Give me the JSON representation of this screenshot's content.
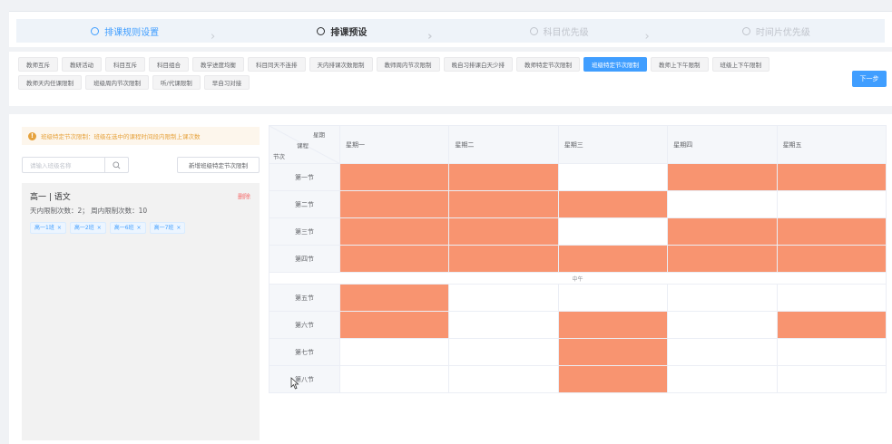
{
  "steps": [
    {
      "label": "排课规则设置",
      "state": "done"
    },
    {
      "label": "排课预设",
      "state": "active"
    },
    {
      "label": "科目优先级",
      "state": "todo"
    },
    {
      "label": "时间片优先级",
      "state": "todo"
    }
  ],
  "tabs": [
    "教师互斥",
    "教研活动",
    "科目互斥",
    "科目组合",
    "教学进度均衡",
    "科目同天不连排",
    "天内排课次数限制",
    "教师周内节次限制",
    "晚自习排课白天少排",
    "教师特定节次限制",
    "班级特定节次限制",
    "教师上下午限制",
    "班级上下午限制",
    "教师天内任课限制",
    "班级周内节次限制",
    "听/代课限制",
    "早自习对接"
  ],
  "active_tab": "班级特定节次限制",
  "next_button": "下一步",
  "tip": "班级特定节次限制：班级在选中的课程时间段内限制上课次数",
  "search_placeholder": "请输入班级名称",
  "add_button": "新增班级特定节次限制",
  "rule": {
    "title": "高一 | 语文",
    "delete_label": "删除",
    "limits": "天内限制次数：2；  周内限制次数：10",
    "classes": [
      "高一1班",
      "高一2班",
      "高一6班",
      "高一7班"
    ]
  },
  "grid": {
    "corner_week": "星期",
    "corner_course": "课程",
    "corner_period": "节次",
    "days": [
      "星期一",
      "星期二",
      "星期三",
      "星期四",
      "星期五"
    ],
    "noon_label": "中午",
    "periods": [
      {
        "label": "第一节",
        "selected": [
          true,
          true,
          false,
          true,
          true
        ]
      },
      {
        "label": "第二节",
        "selected": [
          true,
          true,
          true,
          false,
          false
        ]
      },
      {
        "label": "第三节",
        "selected": [
          true,
          true,
          false,
          true,
          true
        ]
      },
      {
        "label": "第四节",
        "selected": [
          true,
          true,
          true,
          true,
          true
        ]
      },
      {
        "label": "第五节",
        "selected": [
          true,
          false,
          false,
          false,
          false
        ]
      },
      {
        "label": "第六节",
        "selected": [
          true,
          false,
          true,
          false,
          true
        ]
      },
      {
        "label": "第七节",
        "selected": [
          false,
          false,
          true,
          false,
          false
        ]
      },
      {
        "label": "第八节",
        "selected": [
          false,
          false,
          true,
          false,
          false
        ]
      }
    ],
    "selected_color": "#f89470"
  }
}
